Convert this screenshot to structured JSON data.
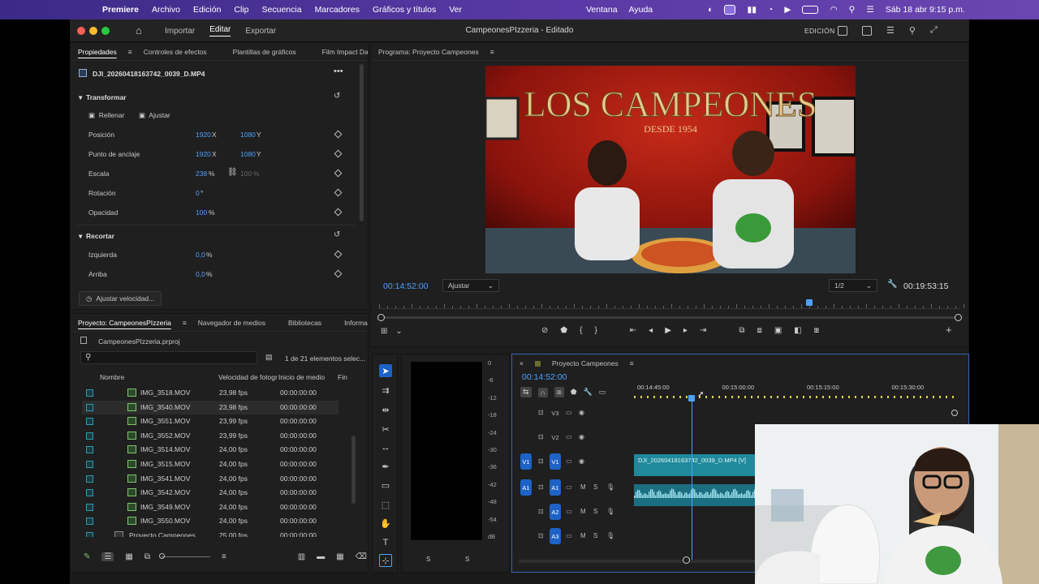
{
  "menubar": {
    "app": "Premiere",
    "menus": [
      "Archivo",
      "Edición",
      "Clip",
      "Secuencia",
      "Marcadores",
      "Gráficos y títulos",
      "Ver"
    ],
    "right_menus": [
      "Ventana",
      "Ayuda"
    ],
    "clock": "Sáb 18 abr 9:15 p.m."
  },
  "window": {
    "title": "CampeonesPIzzeria - Editado",
    "nav": [
      "Importar",
      "Editar",
      "Exportar"
    ],
    "workspace": "EDICIÓN"
  },
  "properties": {
    "tabs": [
      "Propiedades",
      "Controles de efectos",
      "Plantillas de gráficos",
      "Film Impact Dash"
    ],
    "clip_name": "DJI_20260418163742_0039_D.MP4",
    "transform_label": "Transformar",
    "fill_label": "Rellenar",
    "fit_label": "Ajustar",
    "rows": [
      {
        "label": "Posición",
        "v1": "1920",
        "u1": "X",
        "v2": "1080",
        "u2": "Y"
      },
      {
        "label": "Punto de anclaje",
        "v1": "1920",
        "u1": "X",
        "v2": "1080",
        "u2": "Y"
      },
      {
        "label": "Escala",
        "v1": "238",
        "u1": "%",
        "v2": "100",
        "u2": "%"
      },
      {
        "label": "Rotación",
        "v1": "0",
        "u1": "°",
        "v2": "",
        "u2": ""
      },
      {
        "label": "Opacidad",
        "v1": "100",
        "u1": "%",
        "v2": "",
        "u2": ""
      }
    ],
    "crop_label": "Recortar",
    "crop_rows": [
      {
        "label": "Izquierda",
        "v1": "0,0",
        "u1": "%"
      },
      {
        "label": "Arriba",
        "v1": "0,0",
        "u1": "%"
      }
    ],
    "speed_button": "Ajustar velocidad..."
  },
  "program": {
    "tab": "Programa: Proyecto Campeones",
    "timecode": "00:14:52:00",
    "fit": "Ajustar",
    "resolution": "1/2",
    "duration": "00:19:53:15",
    "video_sign": "LOS CAMPEONES",
    "video_sub": "DESDE 1954",
    "playhead_fraction": 0.74
  },
  "project": {
    "tabs": [
      "Proyecto: CampeonesPIzzeria",
      "Navegador de medios",
      "Bibliotecas",
      "Informa"
    ],
    "file": "CampeonesPIzzeria.prproj",
    "count": "1 de 21 elementos selec...",
    "columns": [
      "Nombre",
      "Velocidad de fotogr",
      "Inicio de medio",
      "Fin"
    ],
    "items": [
      {
        "name": "IMG_3518.MOV",
        "fps": "23,98 fps",
        "start": "00:00:00:00"
      },
      {
        "name": "IMG_3540.MOV",
        "fps": "23,98 fps",
        "start": "00:00:00:00"
      },
      {
        "name": "IMG_3551.MOV",
        "fps": "23,99 fps",
        "start": "00:00:00:00"
      },
      {
        "name": "IMG_3552.MOV",
        "fps": "23,99 fps",
        "start": "00:00:00:00"
      },
      {
        "name": "IMG_3514.MOV",
        "fps": "24,00 fps",
        "start": "00:00:00:00"
      },
      {
        "name": "IMG_3515.MOV",
        "fps": "24,00 fps",
        "start": "00:00:00:00"
      },
      {
        "name": "IMG_3541.MOV",
        "fps": "24,00 fps",
        "start": "00:00:00:00"
      },
      {
        "name": "IMG_3542.MOV",
        "fps": "24,00 fps",
        "start": "00:00:00:00"
      },
      {
        "name": "IMG_3549.MOV",
        "fps": "24,00 fps",
        "start": "00:00:00:00"
      },
      {
        "name": "IMG_3550.MOV",
        "fps": "24,00 fps",
        "start": "00:00:00:00"
      },
      {
        "name": "Proyecto Campeones",
        "fps": "25,00 fps",
        "start": "00:00:00:00"
      }
    ]
  },
  "meters": {
    "scale": [
      "0",
      "-6",
      "-12",
      "-18",
      "-24",
      "-30",
      "-36",
      "-42",
      "-48",
      "-54",
      "dB"
    ],
    "channels": [
      "S",
      "S"
    ]
  },
  "timeline": {
    "tab": "Proyecto Campeones",
    "timecode": "00:14:52:00",
    "ruler": [
      "00:14:45:00",
      "00:15:00:00",
      "00:15:15:00",
      "00:15:30:00"
    ],
    "clip_name": "DJI_20260418163742_0039_D.MP4 [V]",
    "video_tracks": [
      "V3",
      "V2",
      "V1"
    ],
    "audio_tracks": [
      "A1",
      "A2",
      "A3"
    ],
    "source_v": "V1",
    "source_a": "A1",
    "mute": "M",
    "solo": "S"
  },
  "colors": {
    "accent": "#4ea1ff",
    "clip": "#1f8a9b",
    "menubar": "#4e34a0"
  }
}
